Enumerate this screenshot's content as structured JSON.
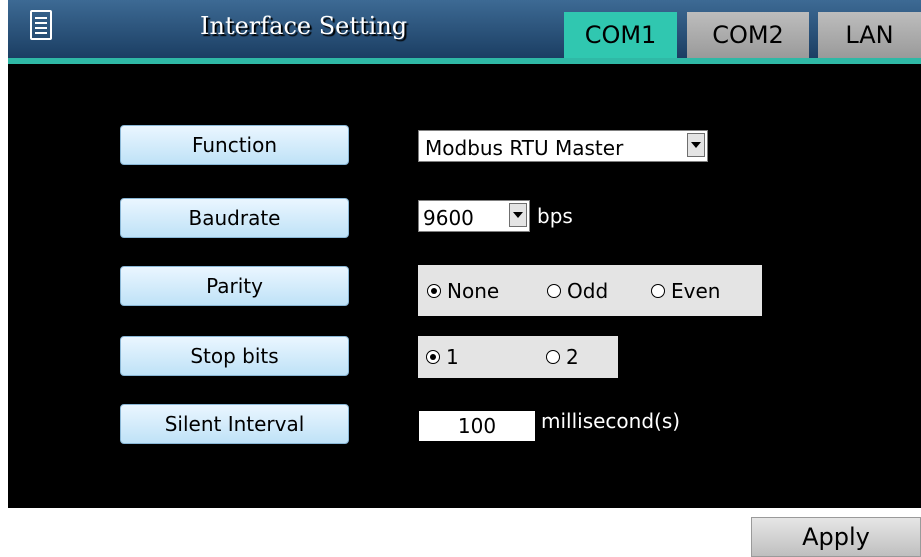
{
  "header": {
    "title": "Interface Setting",
    "menu_icon": "document-menu-icon",
    "tabs": [
      {
        "label": "COM1",
        "active": true
      },
      {
        "label": "COM2",
        "active": false
      },
      {
        "label": "LAN",
        "active": false
      }
    ]
  },
  "form": {
    "function": {
      "label": "Function",
      "value": "Modbus RTU Master"
    },
    "baudrate": {
      "label": "Baudrate",
      "value": "9600",
      "unit": "bps"
    },
    "parity": {
      "label": "Parity",
      "options": [
        "None",
        "Odd",
        "Even"
      ],
      "selected": "None"
    },
    "stop_bits": {
      "label": "Stop bits",
      "options": [
        "1",
        "2"
      ],
      "selected": "1"
    },
    "silent_interval": {
      "label": "Silent Interval",
      "value": "100",
      "unit": "millisecond(s)"
    }
  },
  "apply_label": "Apply",
  "colors": {
    "active_tab": "#30c7b0",
    "panel": "#000000",
    "header": "#2c5580",
    "button_light": "#d7eefc"
  }
}
